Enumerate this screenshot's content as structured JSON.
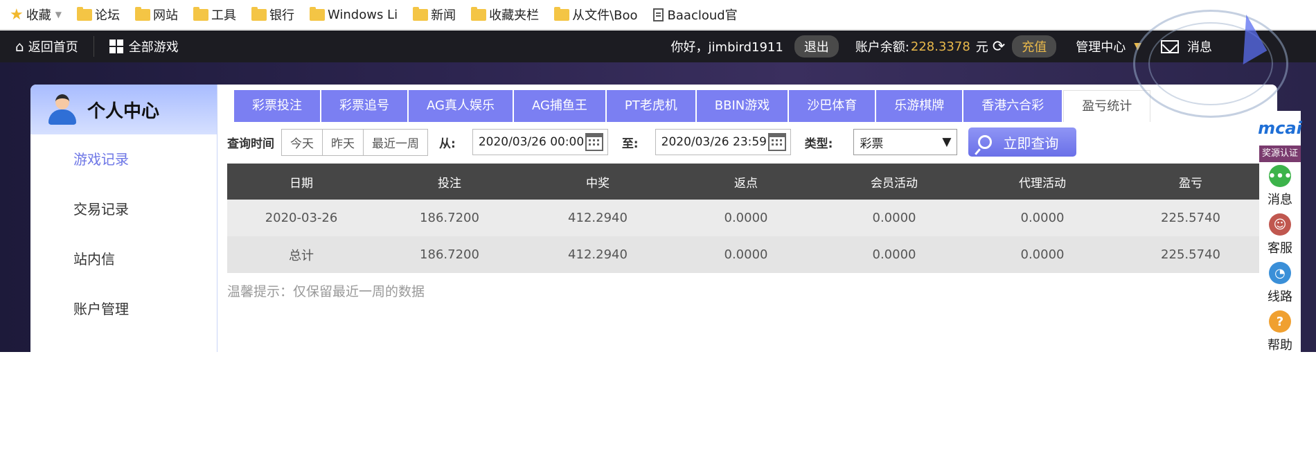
{
  "bookmarks": [
    {
      "label": "收藏",
      "icon": "star-icon",
      "caret": true
    },
    {
      "label": "论坛",
      "icon": "folder-icon"
    },
    {
      "label": "网站",
      "icon": "folder-icon"
    },
    {
      "label": "工具",
      "icon": "folder-icon"
    },
    {
      "label": "银行",
      "icon": "folder-icon"
    },
    {
      "label": "Windows Li",
      "icon": "folder-icon"
    },
    {
      "label": "新闻",
      "icon": "folder-icon"
    },
    {
      "label": "收藏夹栏",
      "icon": "folder-icon"
    },
    {
      "label": "从文件\\Boo",
      "icon": "folder-icon"
    },
    {
      "label": "Baacloud官",
      "icon": "document-icon"
    }
  ],
  "topnav": {
    "home": "返回首页",
    "all_games": "全部游戏",
    "greeting": "你好，jimbird1911",
    "logout": "退出",
    "balance_label": "账户余额:",
    "balance_value": "228.3378",
    "balance_unit": "元",
    "recharge": "充值",
    "manage": "管理中心",
    "messages": "消息"
  },
  "sidebar": {
    "title": "个人中心",
    "items": [
      {
        "label": "游戏记录",
        "active": true
      },
      {
        "label": "交易记录"
      },
      {
        "label": "站内信"
      },
      {
        "label": "账户管理"
      }
    ]
  },
  "tabs": [
    {
      "label": "彩票投注"
    },
    {
      "label": "彩票追号"
    },
    {
      "label": "AG真人娱乐"
    },
    {
      "label": "AG捕鱼王"
    },
    {
      "label": "PT老虎机"
    },
    {
      "label": "BBIN游戏"
    },
    {
      "label": "沙巴体育"
    },
    {
      "label": "乐游棋牌"
    },
    {
      "label": "香港六合彩"
    },
    {
      "label": "盈亏统计",
      "active": true
    }
  ],
  "query": {
    "time_label": "查询时间",
    "quick": [
      "今天",
      "昨天",
      "最近一周"
    ],
    "from_label": "从:",
    "from_value": "2020/03/26 00:00",
    "to_label": "至:",
    "to_value": "2020/03/26 23:59",
    "type_label": "类型:",
    "type_value": "彩票",
    "submit": "立即查询"
  },
  "table": {
    "headers": [
      "日期",
      "投注",
      "中奖",
      "返点",
      "会员活动",
      "代理活动",
      "盈亏"
    ],
    "rows": [
      [
        "2020-03-26",
        "186.7200",
        "412.2940",
        "0.0000",
        "0.0000",
        "0.0000",
        "225.5740"
      ],
      [
        "总计",
        "186.7200",
        "412.2940",
        "0.0000",
        "0.0000",
        "0.0000",
        "225.5740"
      ]
    ]
  },
  "tip": "温馨提示：仅保留最近一周的数据",
  "rightbar": {
    "logo": "mcai",
    "badge": "奖源认证",
    "items": [
      {
        "label": "消息",
        "icon": "chat-icon",
        "color": "#3cb34a"
      },
      {
        "label": "客服",
        "icon": "agent-icon",
        "color": "#c0574f"
      },
      {
        "label": "线路",
        "icon": "speed-icon",
        "color": "#3a8fd8"
      },
      {
        "label": "帮助",
        "icon": "help-icon",
        "color": "#f0a030"
      }
    ]
  },
  "colors": {
    "accent": "#7b7ff2",
    "nav_bg": "#1c1c22",
    "balance": "#e8b84b",
    "table_header": "#464646"
  }
}
